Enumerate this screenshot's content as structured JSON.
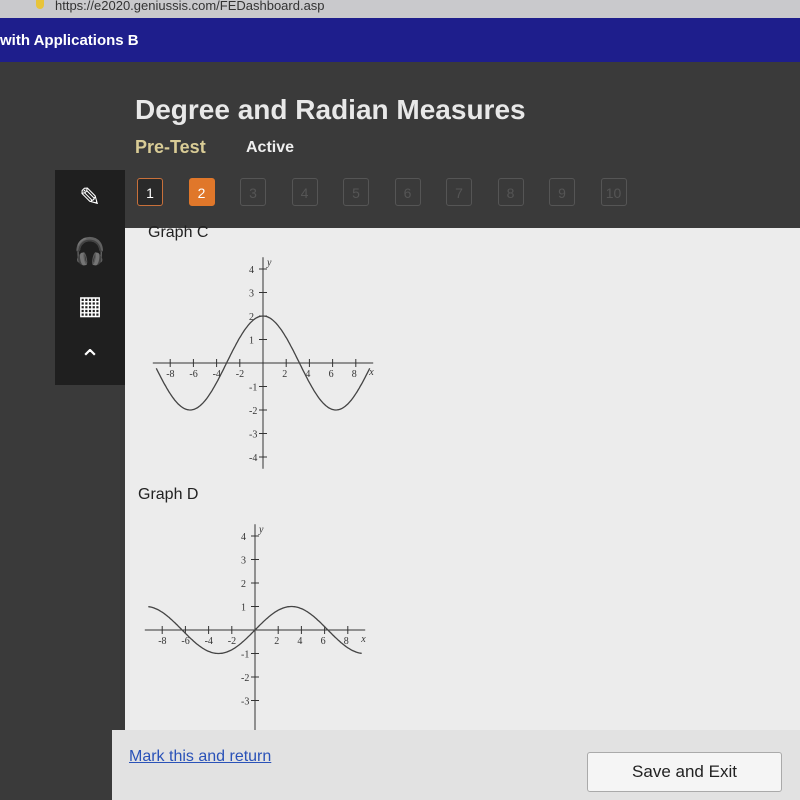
{
  "browser": {
    "url": "https://e2020.geniussis.com/FEDashboard.asp"
  },
  "course": {
    "title": "with Applications B"
  },
  "header": {
    "title": "Degree and Radian Measures",
    "mode": "Pre-Test",
    "status": "Active"
  },
  "questions": [
    {
      "label": "1",
      "state": "done"
    },
    {
      "label": "2",
      "state": "current"
    },
    {
      "label": "3"
    },
    {
      "label": "4"
    },
    {
      "label": "5"
    },
    {
      "label": "6"
    },
    {
      "label": "7"
    },
    {
      "label": "8"
    },
    {
      "label": "9"
    },
    {
      "label": "10"
    }
  ],
  "tools": [
    {
      "icon": "pencil-icon",
      "glyph": "✎"
    },
    {
      "icon": "headphones-icon",
      "glyph": "🎧"
    },
    {
      "icon": "calculator-icon",
      "glyph": "▦"
    },
    {
      "icon": "caret-up-icon",
      "glyph": "⌃"
    }
  ],
  "footer": {
    "mark_label": "Mark this and return",
    "save_label": "Save and Exit"
  },
  "chart_data": [
    {
      "type": "line",
      "title": "Graph C",
      "xlabel": "x",
      "ylabel": "y",
      "xticks": [
        -8,
        -6,
        -4,
        -2,
        2,
        4,
        6,
        8
      ],
      "yticks": [
        -4,
        -3,
        -2,
        -1,
        1,
        2,
        3,
        4
      ],
      "function": "y = 2cos(x/2)",
      "xlim": [
        -9.5,
        9.5
      ],
      "ylim": [
        -4.5,
        4.5
      ]
    },
    {
      "type": "line",
      "title": "Graph D",
      "xlabel": "x",
      "ylabel": "y",
      "xticks": [
        -8,
        -6,
        -4,
        -2,
        2,
        4,
        6,
        8
      ],
      "yticks": [
        -3,
        -2,
        -1,
        1,
        2,
        3,
        4
      ],
      "function": "y = sin(x/2)",
      "xlim": [
        -9.5,
        9.5
      ],
      "ylim": [
        -4.5,
        4.5
      ]
    }
  ]
}
